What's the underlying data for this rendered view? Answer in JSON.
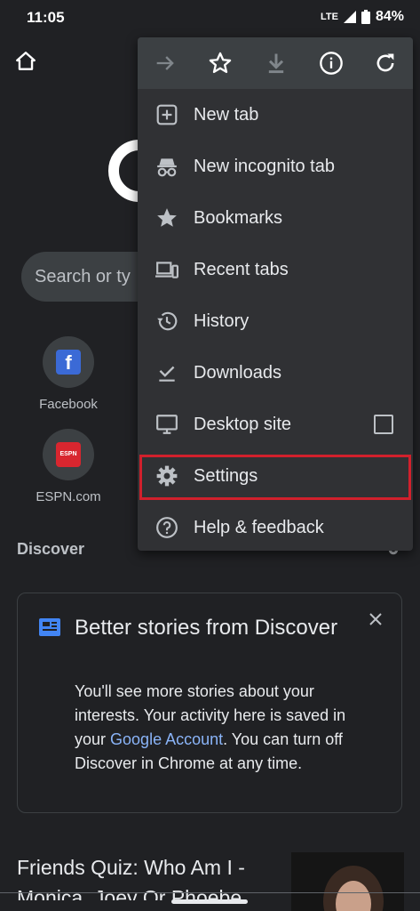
{
  "status": {
    "time": "11:05",
    "network": "LTE",
    "battery": "84%"
  },
  "search": {
    "placeholder": "Search or ty"
  },
  "shortcuts": [
    {
      "label": "Facebook"
    },
    {
      "label": "ESPN.com"
    }
  ],
  "discover": {
    "label": "Discover",
    "card_title": "Better stories from Discover",
    "card_body_1": "You'll see more stories about your interests. Your activity here is saved in your ",
    "card_link": "Google Account",
    "card_body_2": ". You can turn off Discover in Chrome at any time."
  },
  "article": {
    "line1": "Friends Quiz: Who Am I -",
    "line2": "Monica, Joey Or Phoebe"
  },
  "menu": {
    "items": [
      {
        "label": "New tab",
        "icon": "new-tab-icon"
      },
      {
        "label": "New incognito tab",
        "icon": "incognito-icon"
      },
      {
        "label": "Bookmarks",
        "icon": "star-icon"
      },
      {
        "label": "Recent tabs",
        "icon": "devices-icon"
      },
      {
        "label": "History",
        "icon": "history-icon"
      },
      {
        "label": "Downloads",
        "icon": "download-check-icon"
      },
      {
        "label": "Desktop site",
        "icon": "monitor-icon"
      },
      {
        "label": "Settings",
        "icon": "gear-icon"
      },
      {
        "label": "Help & feedback",
        "icon": "help-icon"
      }
    ]
  },
  "colors": {
    "background": "#202124",
    "menu": "#303134",
    "link": "#8ab4f8",
    "highlight": "#d1202c"
  }
}
